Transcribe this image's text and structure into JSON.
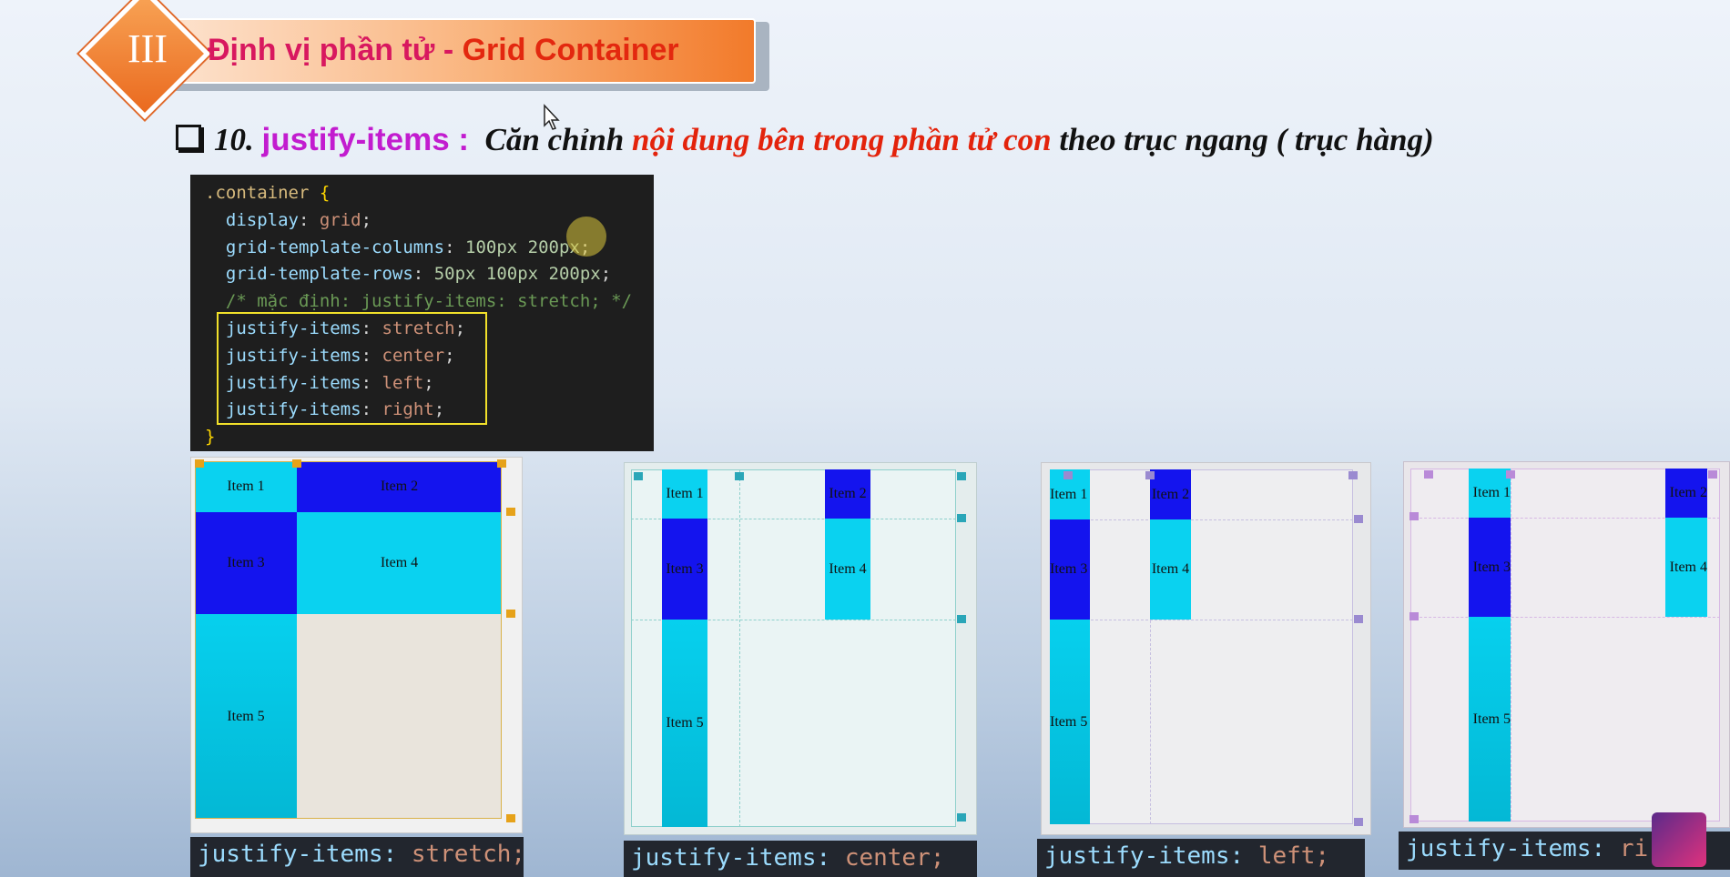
{
  "banner": {
    "numeral": "III",
    "title_part1": "Định vị phần tử - ",
    "title_part2": "Grid Container"
  },
  "heading": {
    "number": "10.",
    "property": "justify-items :",
    "text_before": "Căn chỉnh",
    "text_red": "nội dung bên trong phần tử con",
    "text_after": "theo trục ngang ( trục hàng)"
  },
  "code": {
    "selector": ".container",
    "open_brace": "{",
    "close_brace": "}",
    "lines": [
      {
        "prop": "display",
        "value": "grid",
        "value_type": "kw"
      },
      {
        "prop": "grid-template-columns",
        "value": "100px 200px",
        "value_type": "num"
      },
      {
        "prop": "grid-template-rows",
        "value": "50px 100px 200px",
        "value_type": "num"
      }
    ],
    "comment": "/* mặc định: justify-items: stretch; */",
    "highlighted": [
      {
        "prop": "justify-items",
        "value": "stretch"
      },
      {
        "prop": "justify-items",
        "value": "center"
      },
      {
        "prop": "justify-items",
        "value": "left"
      },
      {
        "prop": "justify-items",
        "value": "right"
      }
    ]
  },
  "demos": [
    {
      "caption_prop": "justify-items:",
      "caption_value": "stretch;",
      "items": [
        "Item 1",
        "Item 2",
        "Item 3",
        "Item 4",
        "Item 5"
      ]
    },
    {
      "caption_prop": "justify-items:",
      "caption_value": "center;",
      "items": [
        "Item 1",
        "Item 2",
        "Item 3",
        "Item 4",
        "Item 5"
      ]
    },
    {
      "caption_prop": "justify-items:",
      "caption_value": "left;",
      "items": [
        "Item 1",
        "Item 2",
        "Item 3",
        "Item 4",
        "Item 5"
      ]
    },
    {
      "caption_prop": "justify-items:",
      "caption_value": "ri",
      "caption_suffix": ";",
      "items": [
        "Item 1",
        "Item 2",
        "Item 3",
        "Item 4",
        "Item 5"
      ]
    }
  ],
  "colors": {
    "cyan": "#0ad2f0",
    "blue": "#1414ee",
    "stretch_tag": "#e6a21a",
    "center_tag": "#2aa6b8",
    "left_tag": "#9a8ad0",
    "right_tag": "#b98ad8"
  },
  "icons": {
    "checkbox": "square-bullet-icon",
    "avatar": "channel-avatar-icon",
    "cursor": "mouse-pointer-icon"
  }
}
